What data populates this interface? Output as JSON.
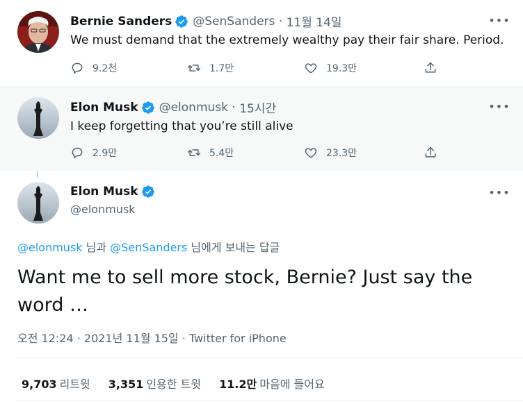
{
  "tweets": [
    {
      "name": "Bernie Sanders",
      "handle": "@SenSanders",
      "time": "11월 14일",
      "text": "We must demand that the extremely wealthy pay their fair share. Period.",
      "replies": "9.2천",
      "retweets": "1.7만",
      "likes": "19.3만"
    },
    {
      "name": "Elon Musk",
      "handle": "@elonmusk",
      "time": "15시간",
      "text": "I keep forgetting that you’re still alive",
      "replies": "2.9만",
      "retweets": "5.4만",
      "likes": "23.3만"
    }
  ],
  "main": {
    "name": "Elon Musk",
    "handle": "@elonmusk",
    "reply_to": {
      "user1": "@elonmusk",
      "conj": " 님과 ",
      "user2": "@SenSanders",
      "suffix": " 님에게 보내는 답글"
    },
    "text": "Want me to sell more stock, Bernie? Just say the word …",
    "timestamp": "오전 12:24 · 2021년 11월 15일 · Twitter for iPhone",
    "stats": [
      {
        "value": "9,703",
        "label": "리트윗"
      },
      {
        "value": "3,351",
        "label": "인용한 트윗"
      },
      {
        "value": "11.2만",
        "label": "마음에 들어요"
      }
    ]
  },
  "colors": {
    "link": "#1d9bf0",
    "muted": "#536471",
    "verified": "#1d9bf0"
  },
  "icons": [
    "reply-icon",
    "retweet-icon",
    "like-icon",
    "share-icon",
    "verified-badge-icon",
    "more-icon"
  ]
}
